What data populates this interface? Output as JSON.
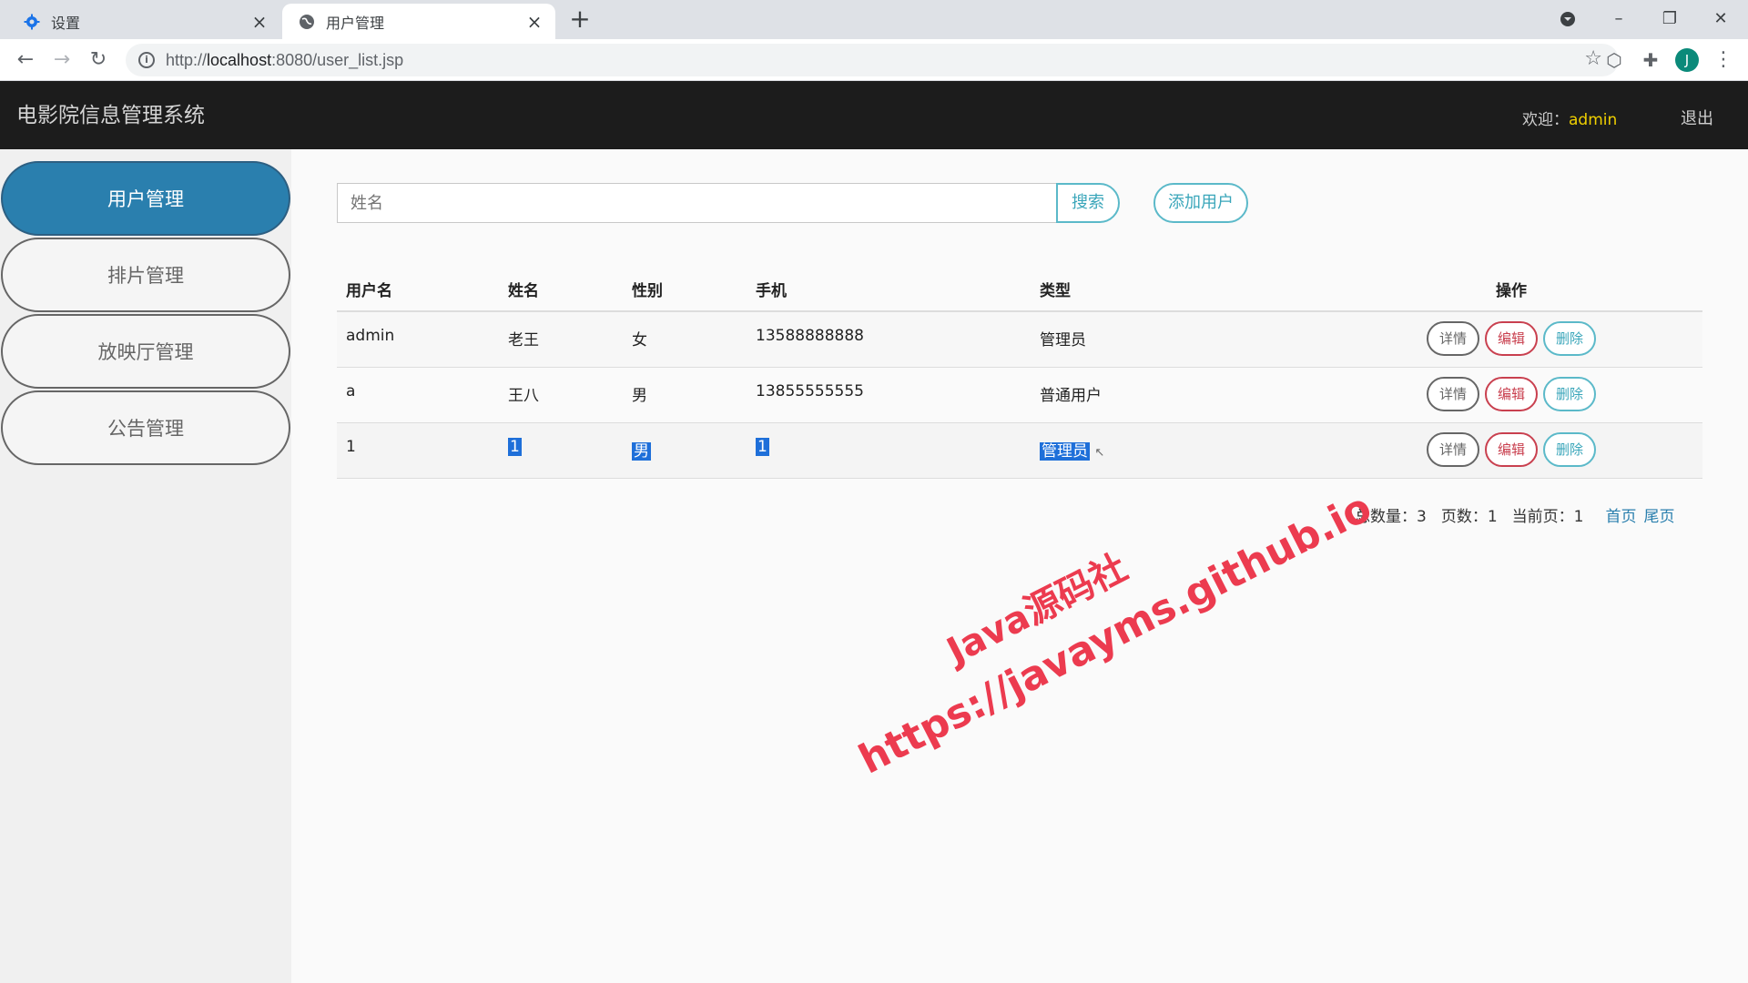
{
  "browser": {
    "tabs": [
      {
        "title": "设置",
        "icon": "gear-icon"
      },
      {
        "title": "用户管理",
        "icon": "globe-icon"
      }
    ],
    "url_proto": "http://",
    "url_host": "localhost",
    "url_rest": ":8080/user_list.jsp"
  },
  "header": {
    "title": "电影院信息管理系统",
    "welcome_label": "欢迎：",
    "username": "admin",
    "logout": "退出"
  },
  "sidebar": {
    "items": [
      {
        "label": "用户管理",
        "active": true
      },
      {
        "label": "排片管理"
      },
      {
        "label": "放映厅管理"
      },
      {
        "label": "公告管理"
      }
    ]
  },
  "toolbar": {
    "search_placeholder": "姓名",
    "search_label": "搜索",
    "add_label": "添加用户"
  },
  "table": {
    "headers": [
      "用户名",
      "姓名",
      "性别",
      "手机",
      "类型",
      "操作"
    ],
    "rows": [
      {
        "username": "admin",
        "name": "老王",
        "gender": "女",
        "phone": "13588888888",
        "type": "管理员"
      },
      {
        "username": "a",
        "name": "王八",
        "gender": "男",
        "phone": "13855555555",
        "type": "普通用户"
      },
      {
        "username": "1",
        "name": "1",
        "gender": "男",
        "phone": "1",
        "type": "管理员"
      }
    ],
    "actions": {
      "detail": "详情",
      "edit": "编辑",
      "delete": "删除"
    }
  },
  "pager": {
    "total": "总数量：3",
    "pages": "页数：1",
    "current": "当前页：1",
    "first": "首页",
    "last": "尾页"
  },
  "watermark": {
    "line1": "Java源码社",
    "line2": "https://javayms.github.io"
  },
  "colors": {
    "header_bg": "#1c1c1c",
    "sidebar_active": "#2a7fae",
    "username_accent": "#f0d000",
    "watermark": "#ec3b4f"
  }
}
